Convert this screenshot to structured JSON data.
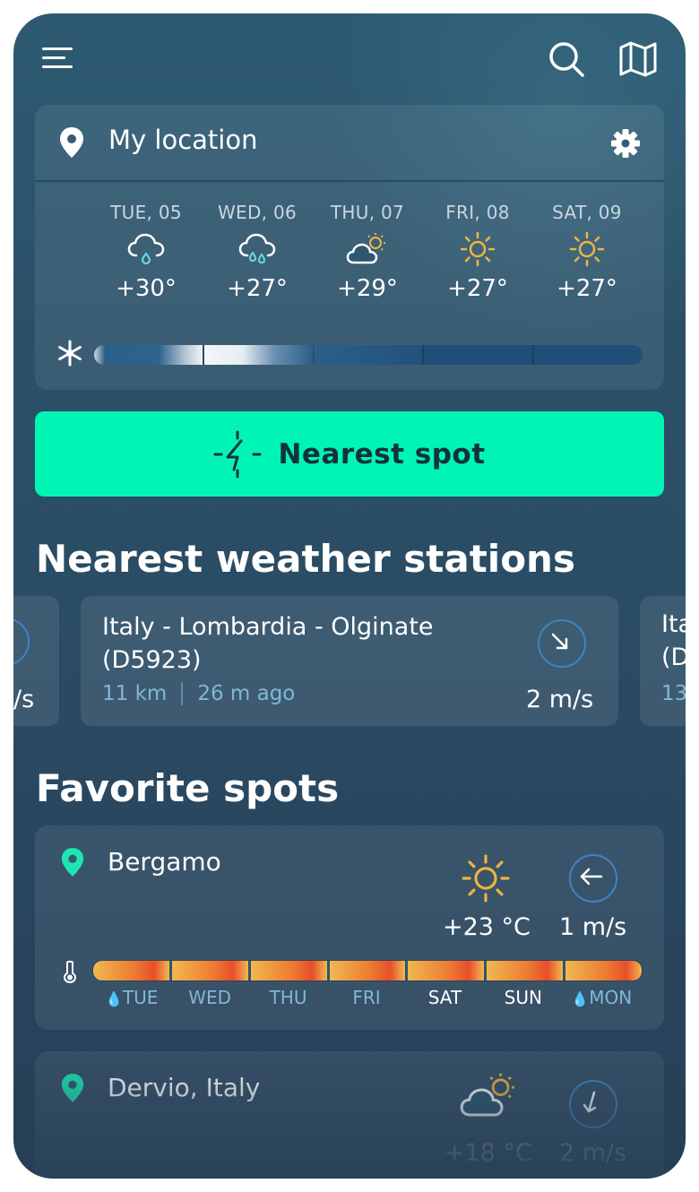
{
  "header": {
    "menu_icon": "menu-icon",
    "search_icon": "search-icon",
    "map_icon": "map-icon"
  },
  "location_card": {
    "title": "My location",
    "settings_icon": "gear-icon",
    "snow_icon": "snowflake-icon",
    "days": [
      {
        "label": "TUE, 05",
        "icon": "rain-cloud-icon",
        "temp": "+30°"
      },
      {
        "label": "WED, 06",
        "icon": "heavy-rain-cloud-icon",
        "temp": "+27°"
      },
      {
        "label": "THU, 07",
        "icon": "partly-cloudy-icon",
        "temp": "+29°"
      },
      {
        "label": "FRI, 08",
        "icon": "sun-icon",
        "temp": "+27°"
      },
      {
        "label": "SAT, 09",
        "icon": "sun-icon",
        "temp": "+27°"
      }
    ]
  },
  "nearest_spot": {
    "label": "Nearest spot",
    "icon": "crosshair-arrow-icon"
  },
  "stations_section": {
    "title": "Nearest weather stations",
    "left_partial": {
      "speed": "/s"
    },
    "main": {
      "name": "Italy - Lombardia - Olginate (D5923)",
      "distance": "11 km",
      "updated": "26 m ago",
      "wind_speed": "2 m/s"
    },
    "right_partial": {
      "name_line1": "Ita",
      "name_line2": "(D",
      "distance": "13"
    }
  },
  "favorites_section": {
    "title": "Favorite spots",
    "spots": [
      {
        "name": "Bergamo",
        "weather_icon": "sun-icon",
        "temp": "+23 °C",
        "wind": "1 m/s",
        "days": [
          "TUE",
          "WED",
          "THU",
          "FRI",
          "SAT",
          "SUN",
          "MON"
        ]
      },
      {
        "name": "Dervio, Italy",
        "weather_icon": "partly-cloudy-icon",
        "temp": "+18 °C",
        "wind": "2 m/s"
      }
    ]
  },
  "colors": {
    "accent": "#00f5b5",
    "background": "#2b5068",
    "muted_text": "#7fb8d8",
    "sun": "#f0b440",
    "wind_ring": "#3e84bf"
  }
}
